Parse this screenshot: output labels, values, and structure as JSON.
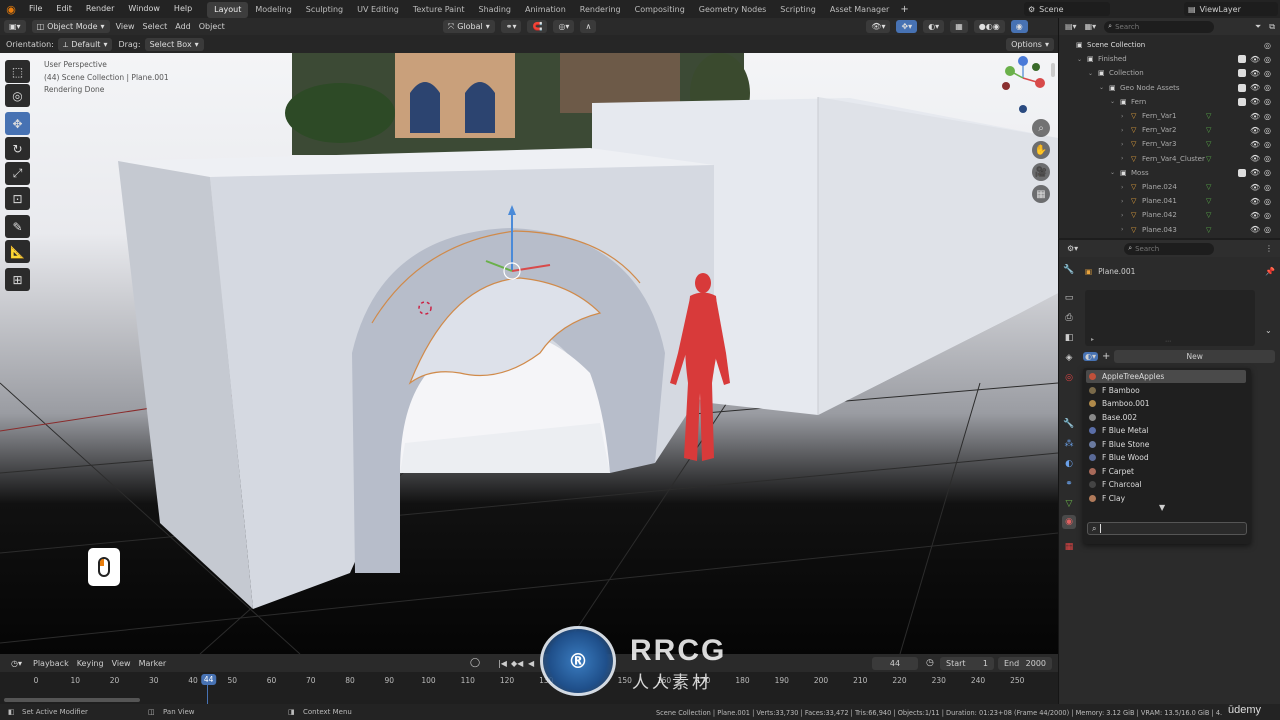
{
  "topbar": {
    "menus": [
      "File",
      "Edit",
      "Render",
      "Window",
      "Help"
    ],
    "workspaces": [
      "Layout",
      "Modeling",
      "Sculpting",
      "UV Editing",
      "Texture Paint",
      "Shading",
      "Animation",
      "Rendering",
      "Compositing",
      "Geometry Nodes",
      "Scripting",
      "Asset Manager"
    ],
    "active_workspace": "Layout",
    "add_tab": "+",
    "scene": "Scene",
    "view_layer": "ViewLayer"
  },
  "viewport_header": {
    "mode": "Object Mode",
    "menus": [
      "View",
      "Select",
      "Add",
      "Object"
    ],
    "transform": "Global"
  },
  "tool_settings": {
    "orientation_label": "Orientation:",
    "orientation_value": "Default",
    "drag_label": "Drag:",
    "drag_value": "Select Box",
    "options": "Options"
  },
  "viewport_info": {
    "line1": "User Perspective",
    "line2": "(44) Scene Collection | Plane.001",
    "line3": "Rendering Done"
  },
  "outliner": {
    "search_placeholder": "Search",
    "rows": [
      {
        "label": "Scene Collection",
        "indent": 0
      },
      {
        "label": "Finished",
        "indent": 1
      },
      {
        "label": "Collection",
        "indent": 2
      },
      {
        "label": "Geo Node Assets",
        "indent": 3
      },
      {
        "label": "Fern",
        "indent": 4
      },
      {
        "label": "Fern_Var1",
        "indent": 5
      },
      {
        "label": "Fern_Var2",
        "indent": 5
      },
      {
        "label": "Fern_Var3",
        "indent": 5
      },
      {
        "label": "Fern_Var4_Cluster",
        "indent": 5
      },
      {
        "label": "Moss",
        "indent": 4
      },
      {
        "label": "Plane.024",
        "indent": 5
      },
      {
        "label": "Plane.041",
        "indent": 5
      },
      {
        "label": "Plane.042",
        "indent": 5
      },
      {
        "label": "Plane.043",
        "indent": 5
      }
    ]
  },
  "properties": {
    "search_placeholder": "Search",
    "object_name": "Plane.001",
    "new_button": "New",
    "add": "+",
    "materials": [
      {
        "name": "AppleTreeApples",
        "color": "#c0503a",
        "selected": true
      },
      {
        "name": "F Bamboo",
        "color": "#7a6a4a"
      },
      {
        "name": "Bamboo.001",
        "color": "#b08a4a"
      },
      {
        "name": "Base.002",
        "color": "#8a8a8a"
      },
      {
        "name": "F Blue Metal",
        "color": "#5a6ea8"
      },
      {
        "name": "F Blue Stone",
        "color": "#6a7aa0"
      },
      {
        "name": "F Blue Wood",
        "color": "#5a6a98"
      },
      {
        "name": "F Carpet",
        "color": "#a86a5a"
      },
      {
        "name": "F Charcoal",
        "color": "#444444"
      },
      {
        "name": "F Clay",
        "color": "#b07a5a"
      }
    ]
  },
  "timeline": {
    "menus": [
      "Playback",
      "Keying",
      "View",
      "Marker"
    ],
    "current_frame": "44",
    "start_label": "Start",
    "start_value": "1",
    "end_label": "End",
    "end_value": "2000",
    "ticks": [
      "0",
      "10",
      "20",
      "30",
      "40",
      "44",
      "50",
      "60",
      "70",
      "80",
      "90",
      "100",
      "110",
      "120",
      "130",
      "140",
      "150",
      "160",
      "170",
      "180",
      "190",
      "200",
      "210",
      "220",
      "230",
      "240",
      "250"
    ]
  },
  "statusbar": {
    "left1": "Set Active Modifier",
    "left2": "Pan View",
    "left3": "Context Menu",
    "stats": "Scene Collection | Plane.001 | Verts:33,730 | Faces:33,472 | Tris:66,940 | Objects:1/11 | Duration: 01:23+08 (Frame 44/2000) | Memory: 3.12 GiB | VRAM: 13.5/16.0 GiB | 4."
  },
  "watermark": {
    "brand": "RRCG",
    "sub": "人人素材",
    "udemy": "ūdemy"
  },
  "colors": {
    "accent": "#4772b3",
    "frame_marker": "#4772b3",
    "viewport_bg": "#0e0e0e",
    "mannequin": "#d83a3a"
  }
}
